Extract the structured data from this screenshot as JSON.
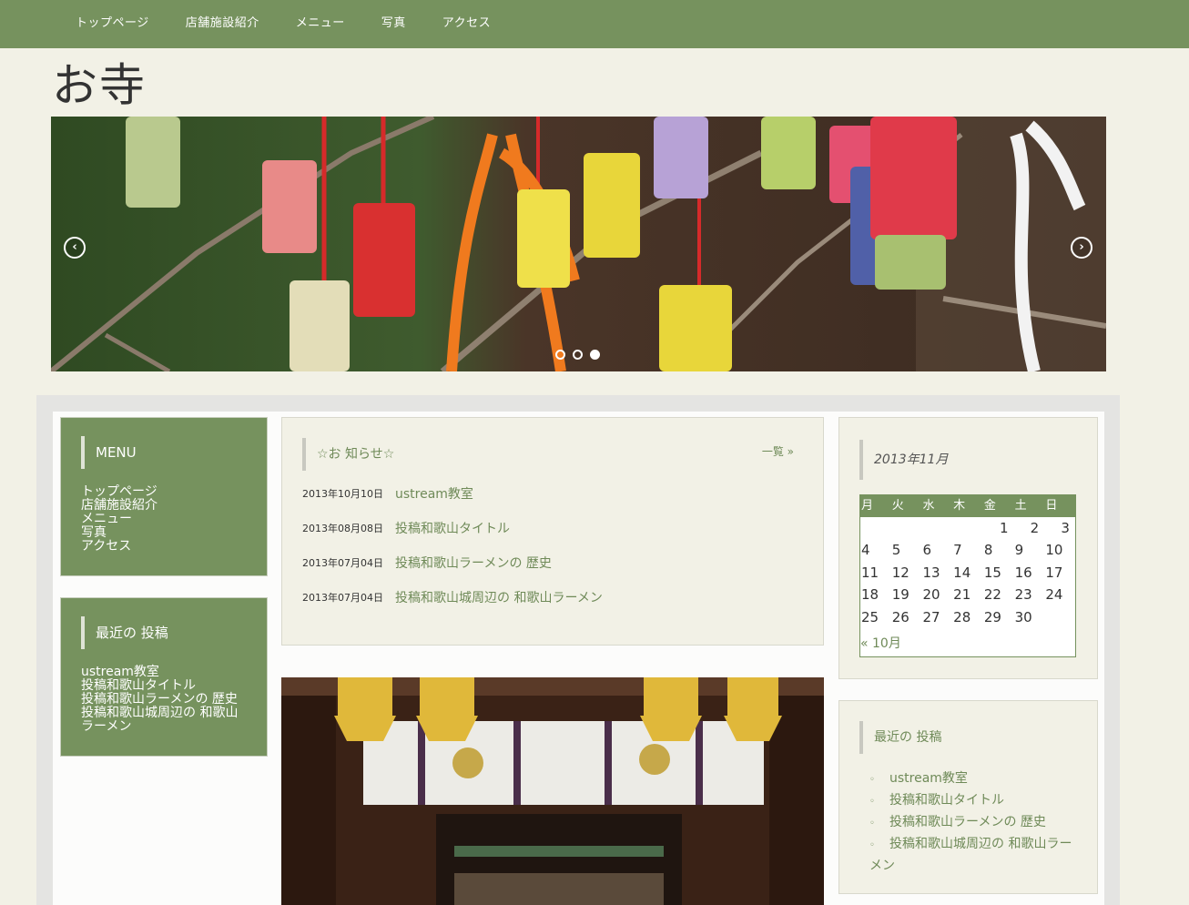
{
  "nav": {
    "items": [
      "トップページ",
      "店舗施設紹介",
      "メニュー",
      "写真",
      "アクセス"
    ]
  },
  "site": {
    "title": "お寺"
  },
  "slider": {
    "prev_icon": "chevron-left-icon",
    "next_icon": "chevron-right-icon",
    "active_index": 2,
    "dot_count": 3
  },
  "left_menu": {
    "title": "MENU",
    "items": [
      "トップページ",
      "店舗施設紹介",
      "メニュー",
      "写真",
      "アクセス"
    ]
  },
  "left_recent": {
    "title": "最近の 投稿",
    "items": [
      "ustream教室",
      "投稿和歌山タイトル",
      "投稿和歌山ラーメンの 歴史",
      "投稿和歌山城周辺の 和歌山ラーメン"
    ]
  },
  "news": {
    "title": "☆お 知らせ☆",
    "more": "一覧 »",
    "items": [
      {
        "date": "2013年10月10日",
        "title": "ustream教室"
      },
      {
        "date": "2013年08月08日",
        "title": "投稿和歌山タイトル"
      },
      {
        "date": "2013年07月04日",
        "title": "投稿和歌山ラーメンの 歴史"
      },
      {
        "date": "2013年07月04日",
        "title": "投稿和歌山城周辺の 和歌山ラーメン"
      }
    ]
  },
  "calendar": {
    "title": "2013年11月",
    "weekdays": [
      "月",
      "火",
      "水",
      "木",
      "金",
      "土",
      "日"
    ],
    "weeks": [
      [
        "",
        "",
        "",
        "",
        "1",
        "2",
        "3"
      ],
      [
        "4",
        "5",
        "6",
        "7",
        "8",
        "9",
        "10"
      ],
      [
        "11",
        "12",
        "13",
        "14",
        "15",
        "16",
        "17"
      ],
      [
        "18",
        "19",
        "20",
        "21",
        "22",
        "23",
        "24"
      ],
      [
        "25",
        "26",
        "27",
        "28",
        "29",
        "30",
        ""
      ]
    ],
    "prev_link": "« 10月"
  },
  "right_recent": {
    "title": "最近の 投稿",
    "bullet": "◦",
    "items": [
      "ustream教室",
      "投稿和歌山タイトル",
      "投稿和歌山ラーメンの 歴史",
      "投稿和歌山城周辺の 和歌山ラーメン"
    ]
  },
  "colors": {
    "accent_green": "#76925e",
    "link_green": "#6f8a58",
    "page_bg": "#f2f1e6"
  }
}
